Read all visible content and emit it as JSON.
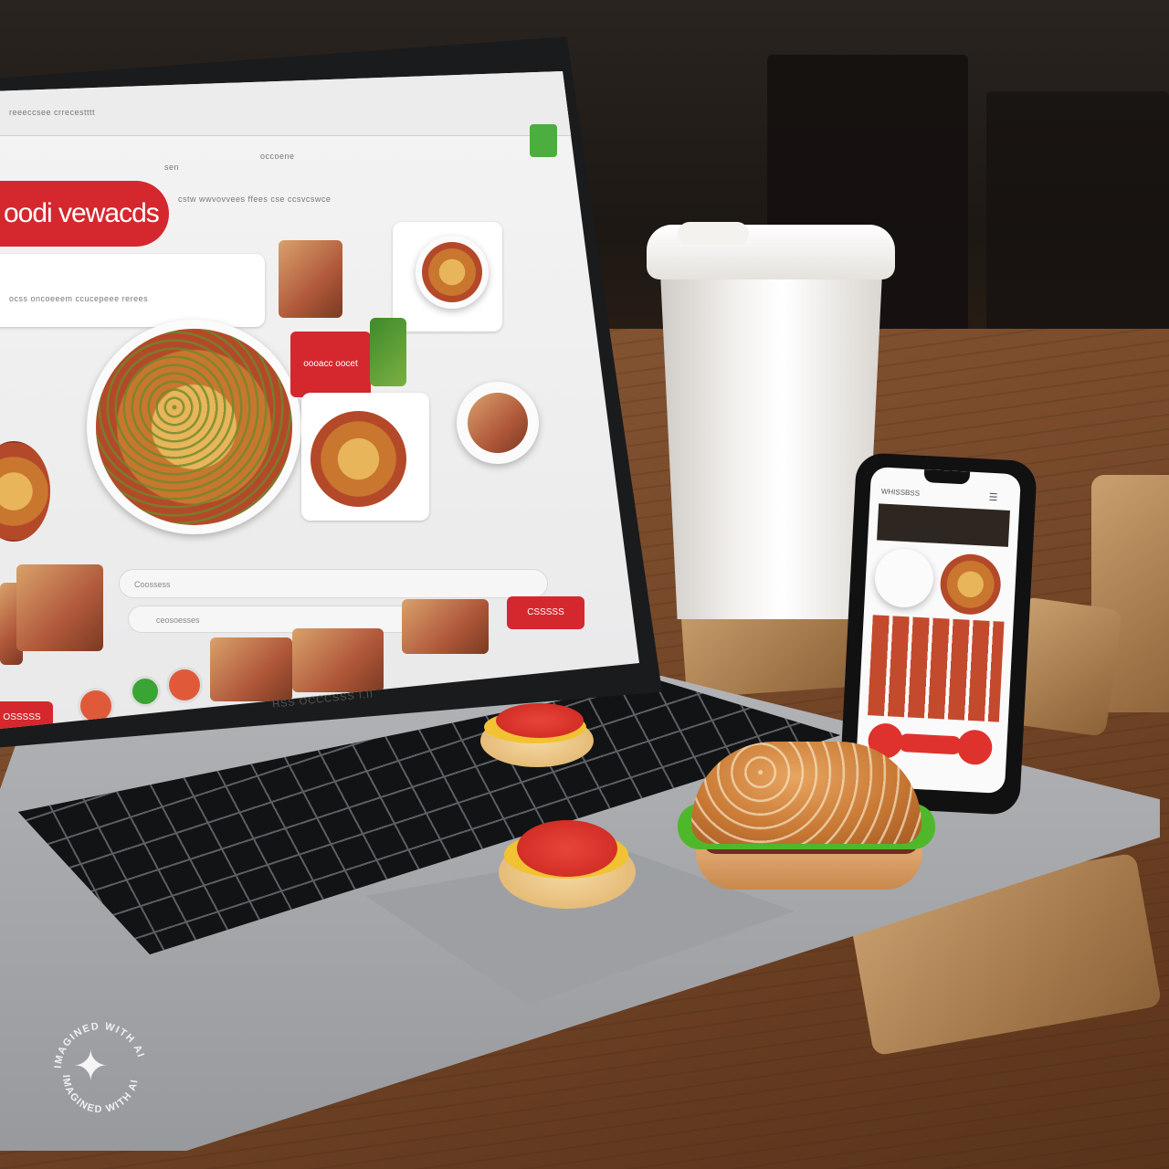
{
  "scene": "laptop-phone-food-delivery",
  "website": {
    "brand_logo": "oodi vewacds",
    "nav": [
      "reeeccsee  crrecestttt",
      "sen",
      "occoene"
    ],
    "top_menu": "cstw  wwvovvees  ffees  cse  ccsvcswce",
    "subtitle": "ocss  oncoeeem  ccucepeee  rerees",
    "promo_text": "oooacc  oocet",
    "search_placeholder": "Coossess",
    "second_search": "ceosoesses",
    "order_button": "CSSSSS",
    "bottom_button": "OSSSSS",
    "chrome_badge": "green-app-icon"
  },
  "laptop": {
    "model_label": "HSS OCCCSSS I.II"
  },
  "phone": {
    "header": "WHISSBSS",
    "menu_icon": "hamburger-icon"
  },
  "watermark": {
    "text_top": "IMAGINED WITH AI",
    "text_bottom": "IMAGINED WITH AI",
    "icon": "sparkle-icon"
  },
  "colors": {
    "brand_red": "#d4282e",
    "table_wood": "#7a4c2c",
    "laptop_gray": "#a4a6aa"
  }
}
